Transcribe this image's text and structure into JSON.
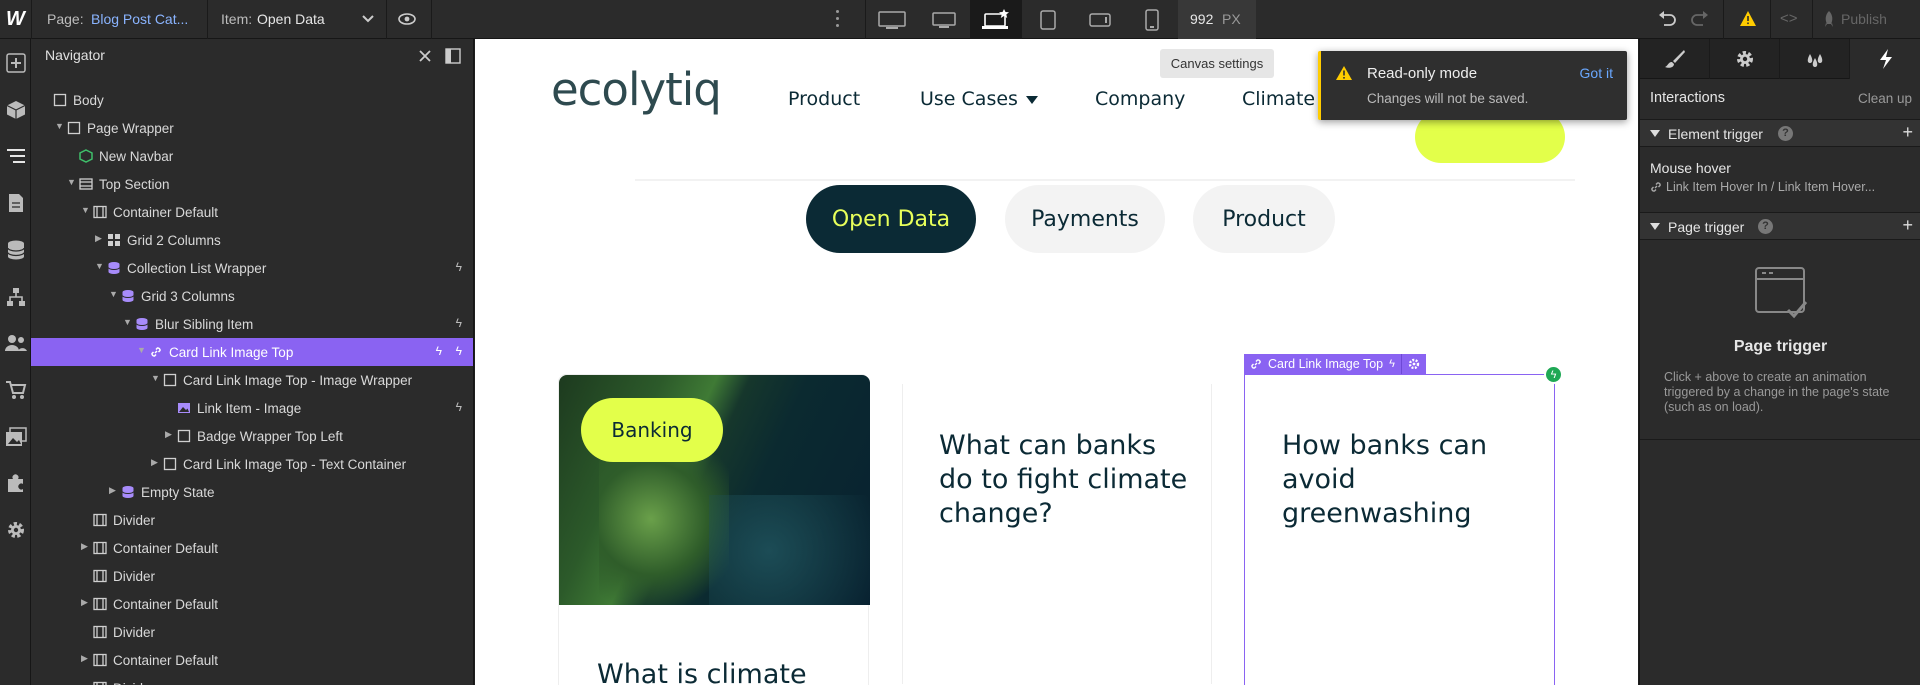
{
  "topbar": {
    "logo": "W",
    "page_label": "Page:",
    "page_value": "Blog Post Cat...",
    "item_label": "Item:",
    "item_value": "Open Data",
    "width_value": "992",
    "width_unit": "PX",
    "publish_label": "Publish",
    "tooltip": "Canvas settings"
  },
  "navigator": {
    "title": "Navigator",
    "items": [
      {
        "label": "Body"
      },
      {
        "label": "Page Wrapper"
      },
      {
        "label": "New Navbar"
      },
      {
        "label": "Top Section"
      },
      {
        "label": "Container Default"
      },
      {
        "label": "Grid 2 Columns"
      },
      {
        "label": "Collection List Wrapper"
      },
      {
        "label": "Grid 3 Columns"
      },
      {
        "label": "Blur Sibling Item"
      },
      {
        "label": "Card Link Image Top"
      },
      {
        "label": "Card Link Image Top - Image Wrapper"
      },
      {
        "label": "Link Item - Image"
      },
      {
        "label": "Badge Wrapper Top Left"
      },
      {
        "label": "Card Link Image Top - Text Container"
      },
      {
        "label": "Empty State"
      },
      {
        "label": "Divider"
      },
      {
        "label": "Container Default"
      },
      {
        "label": "Divider"
      },
      {
        "label": "Container Default"
      },
      {
        "label": "Divider"
      },
      {
        "label": "Container Default"
      },
      {
        "label": "Divider"
      }
    ]
  },
  "site": {
    "logo": "ecolytiq",
    "nav": [
      "Product",
      "Use Cases",
      "Company",
      "Climate Hub"
    ],
    "filters": [
      "Open Data",
      "Payments",
      "Product"
    ],
    "badge": "Banking",
    "card1_title": "What is climate",
    "card2_title": "What can banks do to fight climate change?",
    "card3_title": "How banks can avoid greenwashing",
    "selection_label": "Card Link Image Top"
  },
  "toast": {
    "title": "Read-only mode",
    "message": "Changes will not be saved.",
    "action": "Got it"
  },
  "interactions": {
    "header": "Interactions",
    "clean_up": "Clean up",
    "element_trigger": "Element trigger",
    "mouse_hover": "Mouse hover",
    "mouse_hover_sub": "Link Item Hover In / Link Item Hover...",
    "page_trigger": "Page trigger",
    "empty_title": "Page trigger",
    "empty_desc": "Click + above to create an animation triggered by a change in the page's state (such as on load)."
  },
  "colors": {
    "accent": "#8a63f2",
    "filter_active_bg": "#0b2a35",
    "filter_active_text": "#e8ff5a",
    "badge_bg": "#e3ff4a",
    "toast_bg": "#2f2f2f",
    "warning": "#ffcc00"
  }
}
